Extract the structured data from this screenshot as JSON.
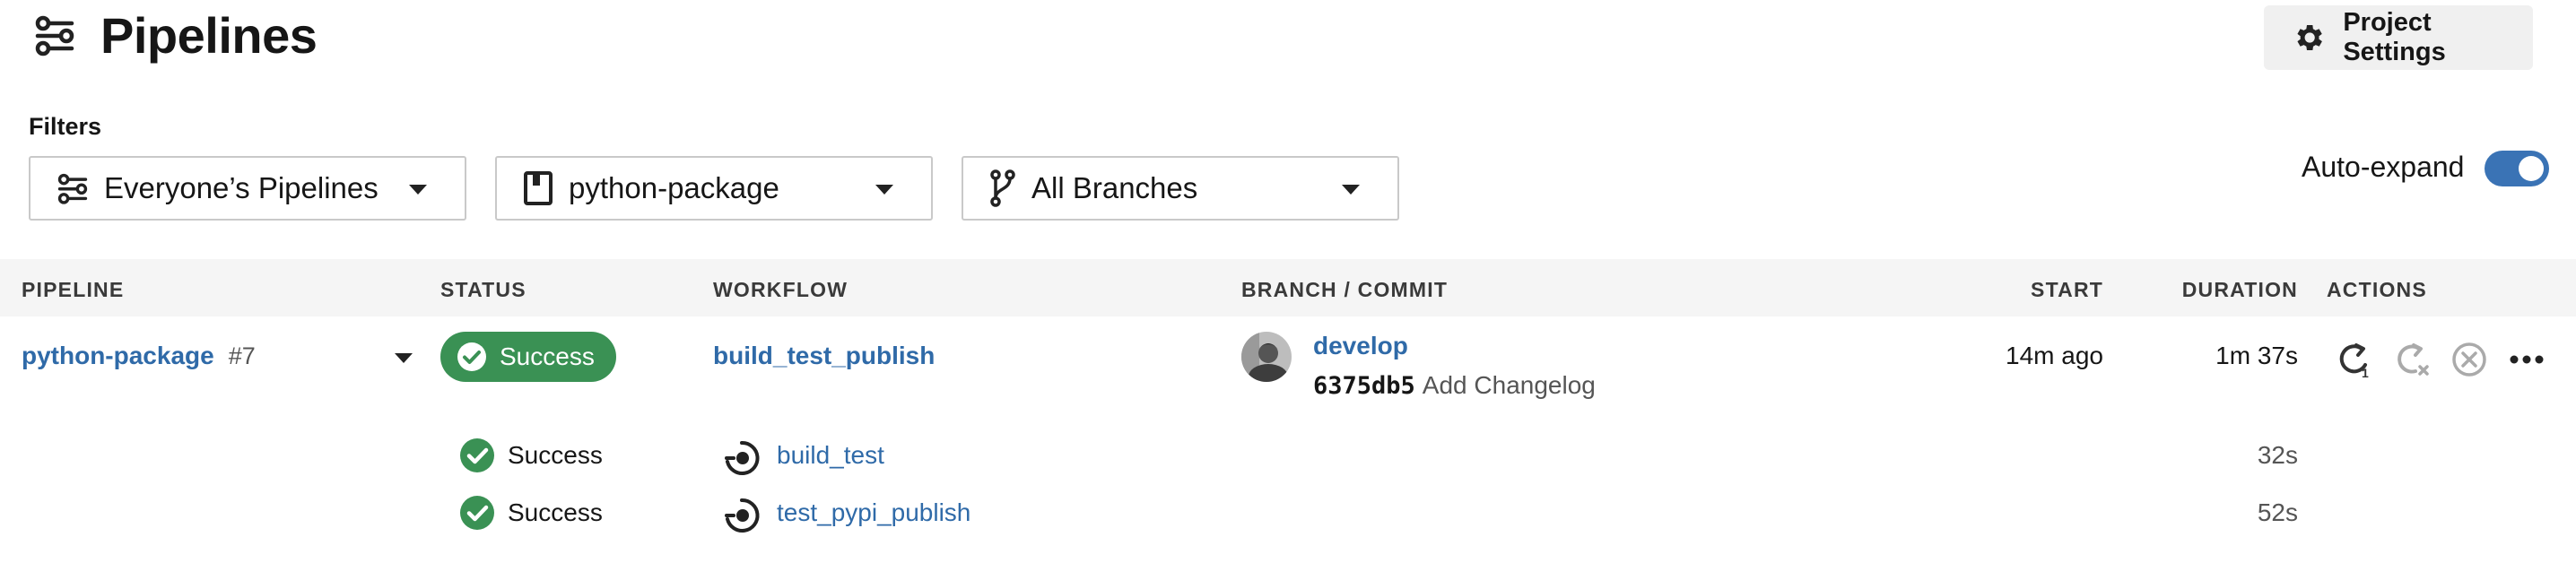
{
  "header": {
    "title": "Pipelines",
    "settings_label": "Project Settings"
  },
  "filters": {
    "label": "Filters",
    "pipelines": "Everyone’s Pipelines",
    "project": "python-package",
    "branches": "All Branches"
  },
  "auto_expand": {
    "label": "Auto-expand",
    "enabled": true
  },
  "table": {
    "headers": [
      "PIPELINE",
      "STATUS",
      "WORKFLOW",
      "BRANCH / COMMIT",
      "START",
      "DURATION",
      "ACTIONS"
    ],
    "pipeline": {
      "name": "python-package",
      "number": "#7",
      "status": "Success",
      "workflow": "build_test_publish",
      "branch": "develop",
      "commit_hash": "6375db5",
      "commit_message": "Add Changelog",
      "start": "14m ago",
      "duration": "1m 37s"
    },
    "jobs": [
      {
        "status": "Success",
        "name": "build_test",
        "duration": "32s"
      },
      {
        "status": "Success",
        "name": "test_pypi_publish",
        "duration": "52s"
      }
    ]
  },
  "colors": {
    "success": "#3a9154",
    "link": "#2f6aa8",
    "toggle": "#3a73b5"
  }
}
